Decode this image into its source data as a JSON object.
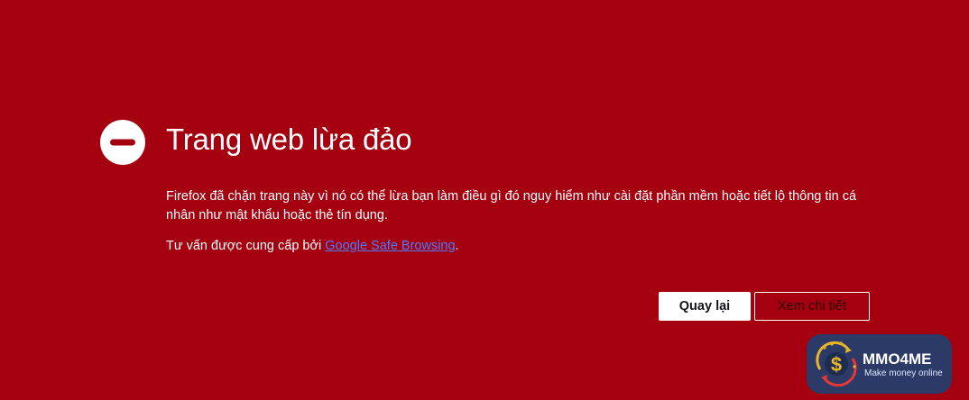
{
  "page": {
    "title": "Trang web lừa đảo",
    "description": "Firefox đã chặn trang này vì nó có thể lừa bạn làm điều gì đó nguy hiểm như cài đặt phần mềm hoặc tiết lộ thông tin cá nhân như mật khẩu hoặc thẻ tín dụng.",
    "advisory_prefix": "Tư vấn được cung cấp bởi ",
    "advisory_link": "Google Safe Browsing",
    "advisory_suffix": "."
  },
  "buttons": {
    "back_label": "Quay lại",
    "details_label": "Xem chi tiết"
  },
  "watermark": {
    "name": "MMO4ME",
    "tagline": "Make money online"
  },
  "icons": {
    "warning": "blocked-icon",
    "logo": "dollar-coin-icon"
  },
  "colors": {
    "background": "#a4000f",
    "text": "#ffffff",
    "link": "#4c7bff",
    "watermark_bg": "#2b3a67",
    "coin": "#e8b52a"
  }
}
